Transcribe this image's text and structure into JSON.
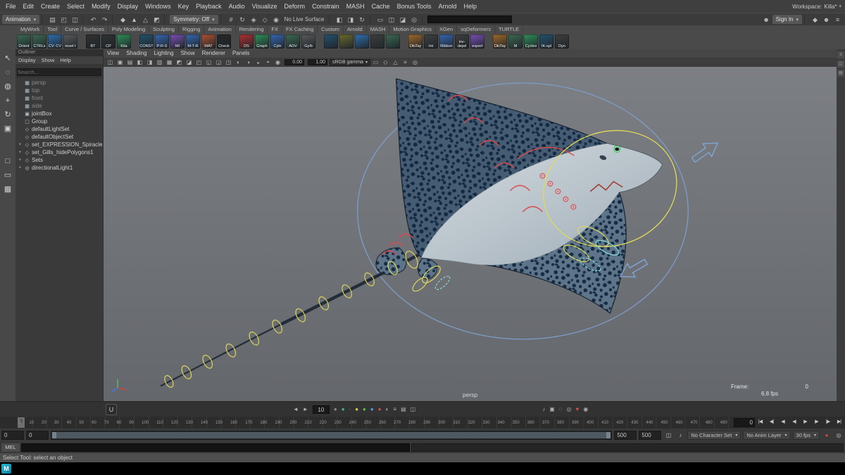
{
  "window": {
    "workspace_label": "Workspace:",
    "workspace_value": "Killa*"
  },
  "menubar": {
    "items": [
      "File",
      "Edit",
      "Create",
      "Select",
      "Modify",
      "Display",
      "Windows",
      "Key",
      "Playback",
      "Audio",
      "Visualize",
      "Deform",
      "Constrain",
      "MASH",
      "Cache",
      "Bonus Tools",
      "Arnold",
      "Help"
    ]
  },
  "statusbar": {
    "elements": [
      {
        "t": "drop",
        "n": "menuset-selector",
        "x": "Animation"
      },
      {
        "t": "div"
      },
      {
        "t": "i",
        "n": "new-scene-icon",
        "g": "▤"
      },
      {
        "t": "i",
        "n": "open-scene-icon",
        "g": "◰"
      },
      {
        "t": "i",
        "n": "save-scene-icon",
        "g": "◫"
      },
      {
        "t": "div"
      },
      {
        "t": "i",
        "n": "undo-icon",
        "g": "↶"
      },
      {
        "t": "i",
        "n": "redo-icon",
        "g": "↷"
      },
      {
        "t": "div"
      },
      {
        "t": "i",
        "n": "select-hierarchy-icon",
        "g": "◆"
      },
      {
        "t": "i",
        "n": "select-object-icon",
        "g": "▲"
      },
      {
        "t": "i",
        "n": "select-component-icon",
        "g": "△"
      },
      {
        "t": "i",
        "n": "highlight-selection-icon",
        "g": "◩"
      },
      {
        "t": "div"
      },
      {
        "t": "drop",
        "n": "symmetry-selector",
        "x": "Symmetry: Off"
      },
      {
        "t": "div"
      },
      {
        "t": "i",
        "n": "snap-to-grids-icon",
        "g": "#"
      },
      {
        "t": "i",
        "n": "snap-to-curves-icon",
        "g": "↻"
      },
      {
        "t": "i",
        "n": "snap-to-points-icon",
        "g": "◈"
      },
      {
        "t": "i",
        "n": "snap-to-planes-icon",
        "g": "◇"
      },
      {
        "t": "i",
        "n": "make-live-icon",
        "g": "◉"
      },
      {
        "t": "lab",
        "n": "live-surface-label",
        "x": "No Live Surface"
      },
      {
        "t": "div"
      },
      {
        "t": "i",
        "n": "input-connections-icon",
        "g": "◧"
      },
      {
        "t": "i",
        "n": "output-connections-icon",
        "g": "◨"
      },
      {
        "t": "i",
        "n": "construction-history-icon",
        "g": "↻"
      },
      {
        "t": "div"
      },
      {
        "t": "i",
        "n": "render-view-icon",
        "g": "▭"
      },
      {
        "t": "i",
        "n": "render-frame-icon",
        "g": "◫"
      },
      {
        "t": "i",
        "n": "ipr-render-icon",
        "g": "◪"
      },
      {
        "t": "i",
        "n": "render-settings-icon",
        "g": "◎"
      },
      {
        "t": "div"
      },
      {
        "t": "inp",
        "n": "quick-select-input"
      },
      {
        "t": "s p"
      },
      {
        "t": "sp"
      },
      {
        "t": "i",
        "n": "user-icon",
        "g": "☻"
      },
      {
        "t": "drop",
        "n": "sign-in-button",
        "x": "Sign In"
      },
      {
        "t": "div"
      },
      {
        "t": "i",
        "n": "modeling-toolkit-icon",
        "g": "◆"
      },
      {
        "t": "i",
        "n": "character-controls-icon",
        "g": "☻"
      },
      {
        "t": "i",
        "n": "attribute-editor-icon",
        "g": "≡"
      }
    ]
  },
  "shelf": {
    "tabs": [
      "MyWork",
      "Tool",
      "Curve / Surfaces",
      "Poly Modeling",
      "Sculpting",
      "Rigging",
      "Animation",
      "Rendering",
      "FX",
      "FX Caching",
      "Custom",
      "Arnold",
      "MASH",
      "Motion Graphics",
      "XGen",
      "sqDeformers",
      "TURTLE"
    ],
    "items": [
      {
        "c": "#3b6a52",
        "cap": "Orient"
      },
      {
        "c": "#3b6a52",
        "cap": "CTRLs"
      },
      {
        "c": "#2f6fae",
        "cap": "CV: CV"
      },
      {
        "c": "#5a5a5a",
        "cap": "reset t"
      },
      {
        "sp": 1
      },
      {
        "c": "#303030",
        "cap": "BT"
      },
      {
        "c": "#303030",
        "cap": "CP"
      },
      {
        "c": "#2e8f5a",
        "cap": "Kila"
      },
      {
        "sp": 1
      },
      {
        "c": "#23516d",
        "cap": "CONST"
      },
      {
        "c": "#3566b0",
        "cap": "P-R-S"
      },
      {
        "c": "#7a4fb5",
        "cap": "MI"
      },
      {
        "c": "#3566b0",
        "cap": "M-T-R"
      },
      {
        "c": "#b05030",
        "cap": "MAT"
      },
      {
        "c": "#262626",
        "cap": "Check"
      },
      {
        "sp": 1
      },
      {
        "c": "#b03030",
        "cap": "DS"
      },
      {
        "c": "#2e8f5a",
        "cap": "Graph"
      },
      {
        "c": "#3566b0",
        "cap": "Cyln"
      },
      {
        "c": "#3b6a52",
        "cap": "AOV"
      },
      {
        "c": "#5a5a5a",
        "cap": "Gy/b"
      },
      {
        "sp": 1
      },
      {
        "c": "#23516d",
        "cap": ""
      },
      {
        "c": "#6b6b2a",
        "cap": ""
      },
      {
        "c": "#2f6fae",
        "cap": ""
      },
      {
        "c": "#3e3e3e",
        "cap": ""
      },
      {
        "c": "#3b6a52",
        "cap": ""
      },
      {
        "sp": 1
      },
      {
        "c": "#a06a28",
        "cap": "OkiTay"
      },
      {
        "c": "#3e3e3e",
        "cap": "Int"
      },
      {
        "c": "#3566b0",
        "cap": "Ribbon"
      },
      {
        "c": "#3e3e3e",
        "cap": "inv-depd"
      },
      {
        "c": "#7a4fb5",
        "cap": "expert"
      },
      {
        "sp": 1
      },
      {
        "c": "#a06a28",
        "cap": "OkiTay"
      },
      {
        "c": "#3b6a52",
        "cap": "M"
      },
      {
        "c": "#2e8f5a",
        "cap": "Cycles"
      },
      {
        "c": "#23516d",
        "cap": "IK-spl"
      },
      {
        "c": "#3e3e3e",
        "cap": "Dyn"
      }
    ]
  },
  "toolbox": {
    "tools": [
      {
        "n": "select-tool",
        "g": "↖"
      },
      {
        "n": "lasso-select-tool",
        "g": "◌"
      },
      {
        "n": "paint-select-tool",
        "g": "◍"
      },
      {
        "n": "move-tool",
        "g": "+"
      },
      {
        "n": "rotate-tool",
        "g": "↻"
      },
      {
        "n": "scale-tool",
        "g": "▣"
      }
    ],
    "layout_buttons": [
      {
        "n": "last-tool-button",
        "g": "□"
      },
      {
        "n": "single-pane-layout-button",
        "g": "▭"
      },
      {
        "n": "four-pane-layout-button",
        "g": "▦"
      }
    ]
  },
  "outliner": {
    "title": "Outliner",
    "menus": [
      "Display",
      "Show",
      "Help"
    ],
    "search_placeholder": "Search...",
    "icon_glyphs": {
      "cam": "▦",
      "cube": "▣",
      "group": "▢",
      "set": "◇",
      "light": "◎"
    },
    "items": [
      {
        "label": "persp",
        "icon": "cam",
        "dim": 1
      },
      {
        "label": "top",
        "icon": "cam",
        "dim": 1
      },
      {
        "label": "front",
        "icon": "cam",
        "dim": 1
      },
      {
        "label": "side",
        "icon": "cam",
        "dim": 1
      },
      {
        "label": "jointBox",
        "icon": "cube"
      },
      {
        "label": "Group",
        "icon": "group"
      },
      {
        "label": "defaultLightSet",
        "icon": "set"
      },
      {
        "label": "defaultObjectSet",
        "icon": "set"
      },
      {
        "label": "set_EXPRESSION_Spiracles",
        "icon": "set",
        "plus": 1
      },
      {
        "label": "set_Gills_hidePolygons1",
        "icon": "set",
        "plus": 1
      },
      {
        "label": "Sets",
        "icon": "set",
        "plus": 1
      },
      {
        "label": "directionalLight1",
        "icon": "light",
        "plus": 1
      }
    ]
  },
  "viewport": {
    "menus": [
      "View",
      "Shading",
      "Lighting",
      "Show",
      "Renderer",
      "Panels"
    ],
    "toolbar": {
      "icons1": [
        "◫",
        "▣",
        "▤",
        "◧",
        "◨",
        "▥",
        "▦",
        "◩",
        "◪",
        "◰",
        "◱",
        "◲",
        "◳",
        "◐",
        "◑",
        "◒",
        "◓",
        "◉"
      ],
      "exposure": "0.00",
      "gamma": "1.00",
      "view_transform": "sRGB gamma",
      "icons2": [
        "▭",
        "◇",
        "△",
        "≡",
        "◎"
      ]
    },
    "hud": {
      "camera": "persp",
      "frame_label": "Frame:",
      "frame": "0",
      "fps": "6.8 fps"
    }
  },
  "right_strip": {
    "icons": [
      {
        "n": "attribute-editor-toggle-icon",
        "g": "≡"
      },
      {
        "n": "tool-settings-toggle-icon",
        "g": "◫"
      },
      {
        "n": "channel-box-toggle-icon",
        "g": "▤"
      }
    ]
  },
  "timeline_toolbar": {
    "logo": "U",
    "center": [
      {
        "n": "prev-bookmark-icon",
        "g": "◄"
      },
      {
        "n": "next-bookmark-icon",
        "g": "►"
      },
      {
        "f": "10",
        "n": "frame-step-field"
      },
      {
        "n": "key-gray-dot-icon",
        "g": "●",
        "c": "#8d8d8d"
      },
      {
        "n": "key-teal-dot-icon",
        "g": "●",
        "c": "#3fb5a3"
      },
      {
        "n": "tick-divider-icon",
        "g": "·"
      },
      {
        "n": "key-yellow-dot-icon",
        "g": "●",
        "c": "#d9d341"
      },
      {
        "n": "key-green-dot-icon",
        "g": "●",
        "c": "#63c04f"
      },
      {
        "n": "key-blue-dot-icon",
        "g": "●",
        "c": "#4f9fd8"
      },
      {
        "n": "key-red-dot-icon",
        "g": "●",
        "c": "#d35050"
      },
      {
        "n": "half-circle-icon",
        "g": "◐"
      },
      {
        "n": "list-icon",
        "g": "≡"
      },
      {
        "n": "bars-icon",
        "g": "▤"
      },
      {
        "n": "slider-icon",
        "g": "◫"
      }
    ],
    "right": [
      {
        "n": "sound-icon",
        "g": "♪"
      },
      {
        "n": "camera-icon",
        "g": "▣"
      },
      {
        "n": "ghost-icon",
        "g": "◌"
      },
      {
        "n": "bell-icon",
        "g": "◎"
      },
      {
        "n": "heart-icon",
        "g": "♥",
        "c": "#d35050"
      },
      {
        "n": "search-icon",
        "g": "◉"
      }
    ]
  },
  "timeline": {
    "start": 0,
    "end": 500,
    "label_step": 10,
    "current": "0",
    "current_time": "0",
    "transport": [
      {
        "n": "go-to-start-button",
        "g": "|◀"
      },
      {
        "n": "prev-key-button",
        "g": "◀|"
      },
      {
        "n": "step-back-button",
        "g": "◀"
      },
      {
        "n": "play-back-button",
        "g": "◀"
      },
      {
        "n": "play-button",
        "g": "▶"
      },
      {
        "n": "step-forward-button",
        "g": "▶"
      },
      {
        "n": "next-key-button",
        "g": "|▶"
      },
      {
        "n": "go-to-end-button",
        "g": "▶|"
      }
    ]
  },
  "range": {
    "left_fields": [
      "0",
      "0"
    ],
    "right_fields": [
      "500",
      "500"
    ],
    "character_set": "No Character Set",
    "anim_layer": "No Anim Layer",
    "fps": "30 fps",
    "icons_a": [
      {
        "n": "playback-speed-icon",
        "g": "◫"
      },
      {
        "n": "mute-sound-icon",
        "g": "♪"
      }
    ],
    "icons_b": [
      {
        "n": "auto-key-icon",
        "g": "●",
        "c": "#d64545"
      },
      {
        "n": "animation-preferences-icon",
        "g": "◎"
      }
    ]
  },
  "command_line": {
    "label": "MEL"
  },
  "help_line": {
    "text": "Select Tool: select an object"
  },
  "logo": "M",
  "colors": {
    "viewport_top": "#7c7f84",
    "viewport_bottom": "#64676c",
    "rig_yellow": "#ddd75a",
    "rig_red": "#d94b4b",
    "rig_blue": "#7e9cc8",
    "rig_cyan": "#7fd8d8",
    "accent_teal": "#27b6c9"
  }
}
